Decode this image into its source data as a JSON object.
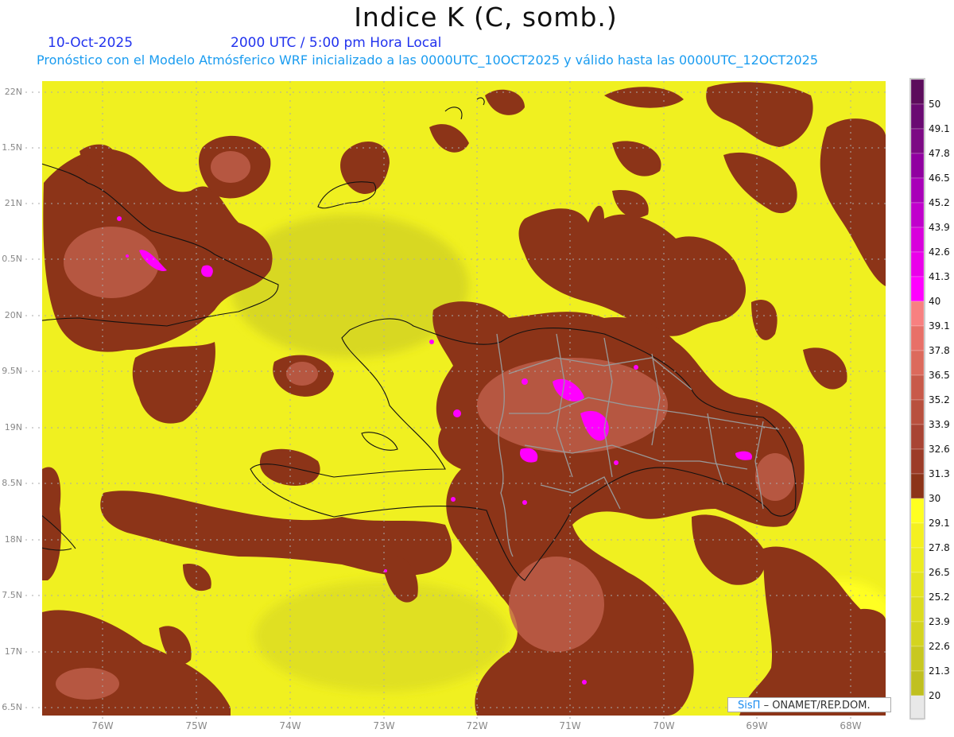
{
  "header": {
    "title": "Indice K (C, somb.)",
    "date": "10-Oct-2025",
    "time": "2000 UTC / 5:00 pm Hora Local",
    "subtitle": "Pronóstico con el Modelo Atmósferico WRF inicializado a las 0000UTC_10OCT2025 y válido hasta las  0000UTC_12OCT2025"
  },
  "axes": {
    "lat_labels": [
      "22N",
      "1.5N",
      "21N",
      "0.5N",
      "20N",
      "9.5N",
      "19N",
      "8.5N",
      "18N",
      "7.5N",
      "17N",
      "6.5N"
    ],
    "lon_labels": [
      "76W",
      "75W",
      "74W",
      "73W",
      "72W",
      "71W",
      "70W",
      "69W",
      "68W"
    ]
  },
  "colorbar": {
    "labels": [
      "50",
      "49.1",
      "47.8",
      "46.5",
      "45.2",
      "43.9",
      "42.6",
      "41.3",
      "40",
      "39.1",
      "37.8",
      "36.5",
      "35.2",
      "33.9",
      "32.6",
      "31.3",
      "30",
      "29.1",
      "27.8",
      "26.5",
      "25.2",
      "23.9",
      "22.6",
      "21.3",
      "20"
    ],
    "colors": [
      "#5c0c5c",
      "#6a0a72",
      "#7c0a84",
      "#9000a0",
      "#a800b8",
      "#c000cc",
      "#d800dc",
      "#ea00ea",
      "#ff00ff",
      "#f88080",
      "#e87068",
      "#dc6a5c",
      "#c85a4a",
      "#b8503e",
      "#a84434",
      "#9c3c28",
      "#8c3418",
      "#ffff20",
      "#f4f020",
      "#ecec20",
      "#e4e420",
      "#dcdc20",
      "#d4d420",
      "#c8c820",
      "#c0c020",
      "#e8e8e8"
    ]
  },
  "credit": {
    "logo": "SisΠ",
    "text": "– ONAMET/REP.DOM."
  }
}
